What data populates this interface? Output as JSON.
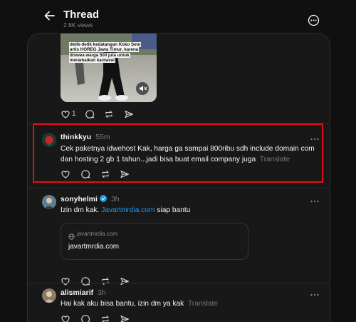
{
  "header": {
    "title": "Thread",
    "views": "2.8K views"
  },
  "video": {
    "caption": "detik-detik kedatangan Koko Seto artis HOREG Jawa Timur, karena diswea warga 500 juta untuk meramaikan karnaval"
  },
  "first_post_actions": {
    "like_count": "1"
  },
  "posts": [
    {
      "username": "thinkkyu",
      "time": "55m",
      "text": "Cek paketnya idwehost Kak, harga ga sampai 800ribu sdh include domain com dan hosting 2 gb 1 tahun...jadi bisa buat email company juga",
      "translate": "Translate"
    },
    {
      "username": "sonyhelmi",
      "time": "3h",
      "text_before": "Izin dm kak.",
      "link": "Javartmrdia.com",
      "text_after": "siap bantu",
      "card_domain": "javartmrdia.com",
      "card_title": "javartmrdia.com"
    },
    {
      "username": "alismiarif",
      "time": "3h",
      "text": "Hai kak aku bisa bantu, izin dm ya kak",
      "translate": "Translate"
    }
  ],
  "colors": {
    "background": "#101010",
    "panel": "#181818",
    "link": "#1d9bf0",
    "highlight": "#e0101a",
    "verified": "#1d9bf0"
  },
  "icons": [
    "back-arrow-icon",
    "more-circle-icon",
    "heart-icon",
    "comment-icon",
    "repost-icon",
    "share-icon",
    "mute-icon",
    "globe-icon",
    "verified-icon",
    "dots-icon"
  ]
}
